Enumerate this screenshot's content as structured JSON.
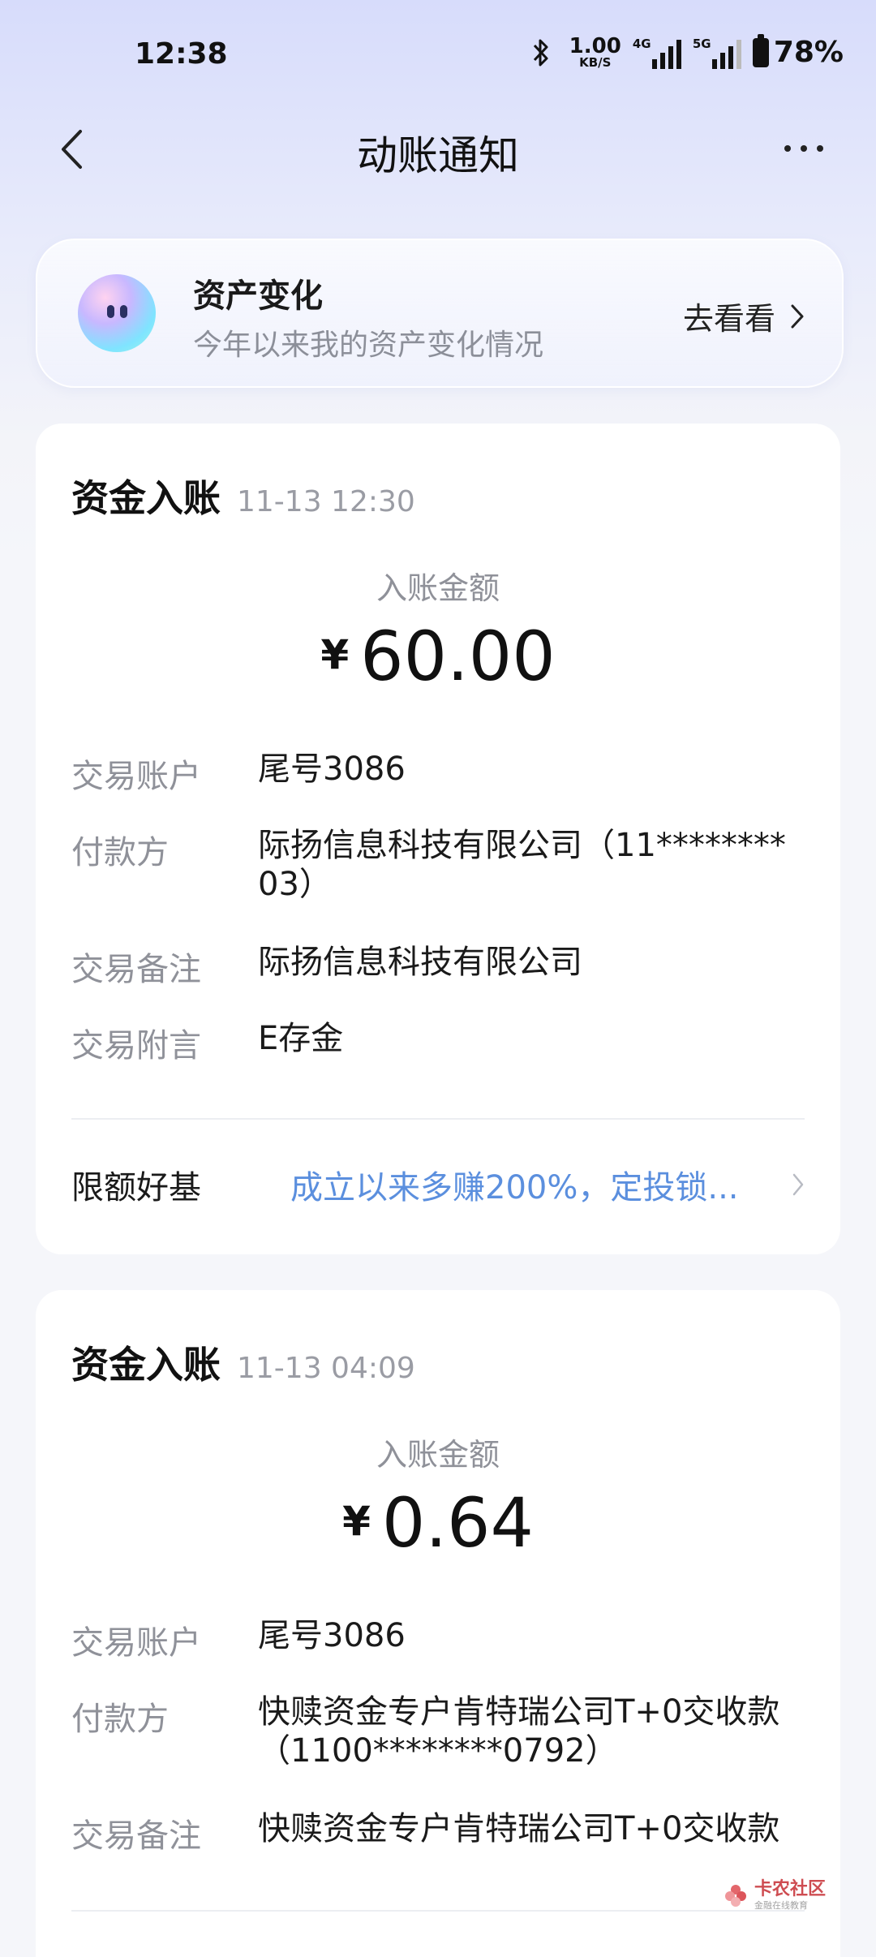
{
  "status_bar": {
    "time": "12:38",
    "net_speed_value": "1.00",
    "net_speed_unit": "KB/S",
    "sim1": "4G",
    "sim2": "5G",
    "battery": "78%"
  },
  "nav": {
    "title": "动账通知"
  },
  "asset_banner": {
    "title": "资产变化",
    "subtitle": "今年以来我的资产变化情况",
    "action": "去看看"
  },
  "labels": {
    "amount_label": "入账金额",
    "currency": "¥",
    "account": "交易账户",
    "payer": "付款方",
    "remark": "交易备注",
    "postscript": "交易附言"
  },
  "transactions": [
    {
      "type": "资金入账",
      "datetime": "11-13 12:30",
      "amount": "60.00",
      "account": "尾号3086",
      "payer_line1": "际扬信息科技有限公司（11********",
      "payer_line2": "03）",
      "remark": "际扬信息科技有限公司",
      "postscript": "E存金",
      "promo_key": "限额好基",
      "promo_text": "成立以来多赚200%，定投锁..."
    },
    {
      "type": "资金入账",
      "datetime": "11-13 04:09",
      "amount": "0.64",
      "account": "尾号3086",
      "payer_line1": "快赎资金专户肯特瑞公司T+0交收款",
      "payer_line2": "（1100********0792）",
      "remark": "快赎资金专户肯特瑞公司T+0交收款"
    }
  ],
  "watermark": {
    "name": "卡农社区",
    "tagline": "金融在线教育"
  },
  "colors": {
    "accent_link": "#5b8fde",
    "label_gray": "#8f9199",
    "watermark_red": "#c9393f"
  }
}
